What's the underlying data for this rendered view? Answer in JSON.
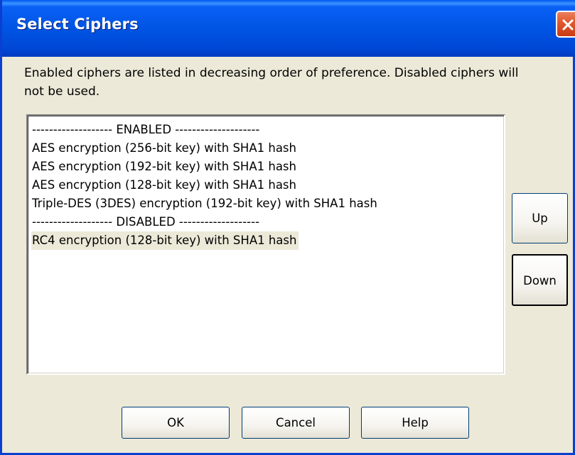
{
  "window": {
    "title": "Select Ciphers",
    "close_icon": "close-x-icon"
  },
  "description": "Enabled ciphers are listed in decreasing order of preference. Disabled ciphers will not be used.",
  "cipher_list": {
    "items": [
      {
        "label": "------------------- ENABLED --------------------",
        "selected": false
      },
      {
        "label": "AES encryption (256-bit key) with SHA1 hash",
        "selected": false
      },
      {
        "label": "AES encryption (192-bit key) with SHA1 hash",
        "selected": false
      },
      {
        "label": "AES encryption (128-bit key) with SHA1 hash",
        "selected": false
      },
      {
        "label": "Triple-DES (3DES) encryption (192-bit key) with SHA1 hash",
        "selected": false
      },
      {
        "label": "------------------- DISABLED -------------------",
        "selected": false
      },
      {
        "label": "RC4 encryption (128-bit key) with SHA1 hash",
        "selected": true
      }
    ]
  },
  "side_buttons": {
    "up_label": "Up",
    "down_label": "Down"
  },
  "footer_buttons": {
    "ok_label": "OK",
    "cancel_label": "Cancel",
    "help_label": "Help"
  },
  "colors": {
    "titlebar": "#0054e3",
    "dialog_bg": "#ece9d8",
    "close_button": "#e35a30",
    "selection_bg": "#ece9d8"
  }
}
